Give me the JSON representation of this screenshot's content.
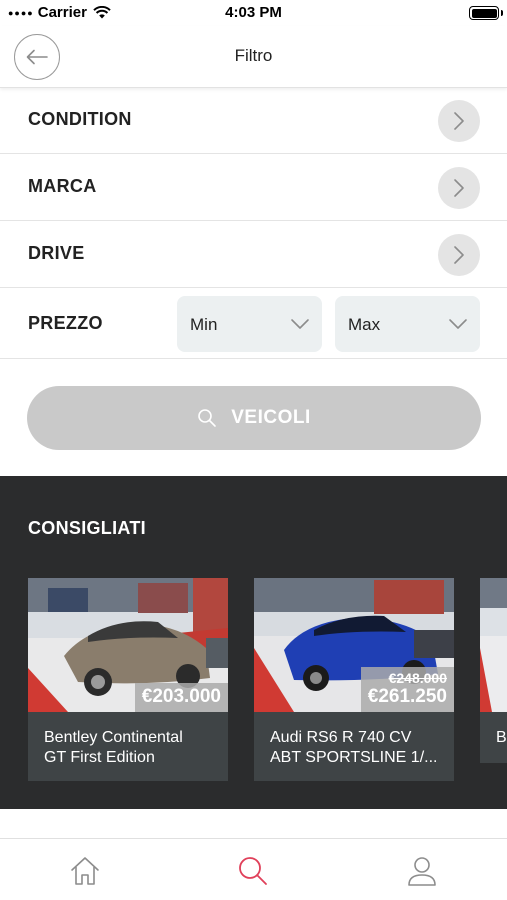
{
  "status_bar": {
    "carrier": "Carrier",
    "time": "4:03 PM"
  },
  "nav": {
    "title": "Filtro"
  },
  "filters": [
    {
      "label": "CONDITION"
    },
    {
      "label": "MARCA"
    },
    {
      "label": "DRIVE"
    }
  ],
  "price_filter": {
    "label": "PREZZO",
    "min": "Min",
    "max": "Max"
  },
  "search_button": {
    "label": "VEICOLI"
  },
  "recommended": {
    "title": "CONSIGLIATI",
    "cars": [
      {
        "name_line1": "Bentley Continental",
        "name_line2": "GT First Edition",
        "price": "€203.000"
      },
      {
        "name_line1": "Audi RS6 R 740 CV",
        "name_line2": "ABT SPORTSLINE 1/...",
        "old_price": "€248.000",
        "price": "€261.250"
      },
      {
        "name_line1": "B"
      }
    ]
  },
  "tabs": [
    {
      "icon": "home-icon"
    },
    {
      "icon": "search-icon"
    },
    {
      "icon": "user-icon"
    }
  ],
  "colors": {
    "accent": "#e0405a",
    "dark_section": "#2b2c2d",
    "button_disabled": "#c9c9c9",
    "select_bg": "#ecf0f1"
  }
}
